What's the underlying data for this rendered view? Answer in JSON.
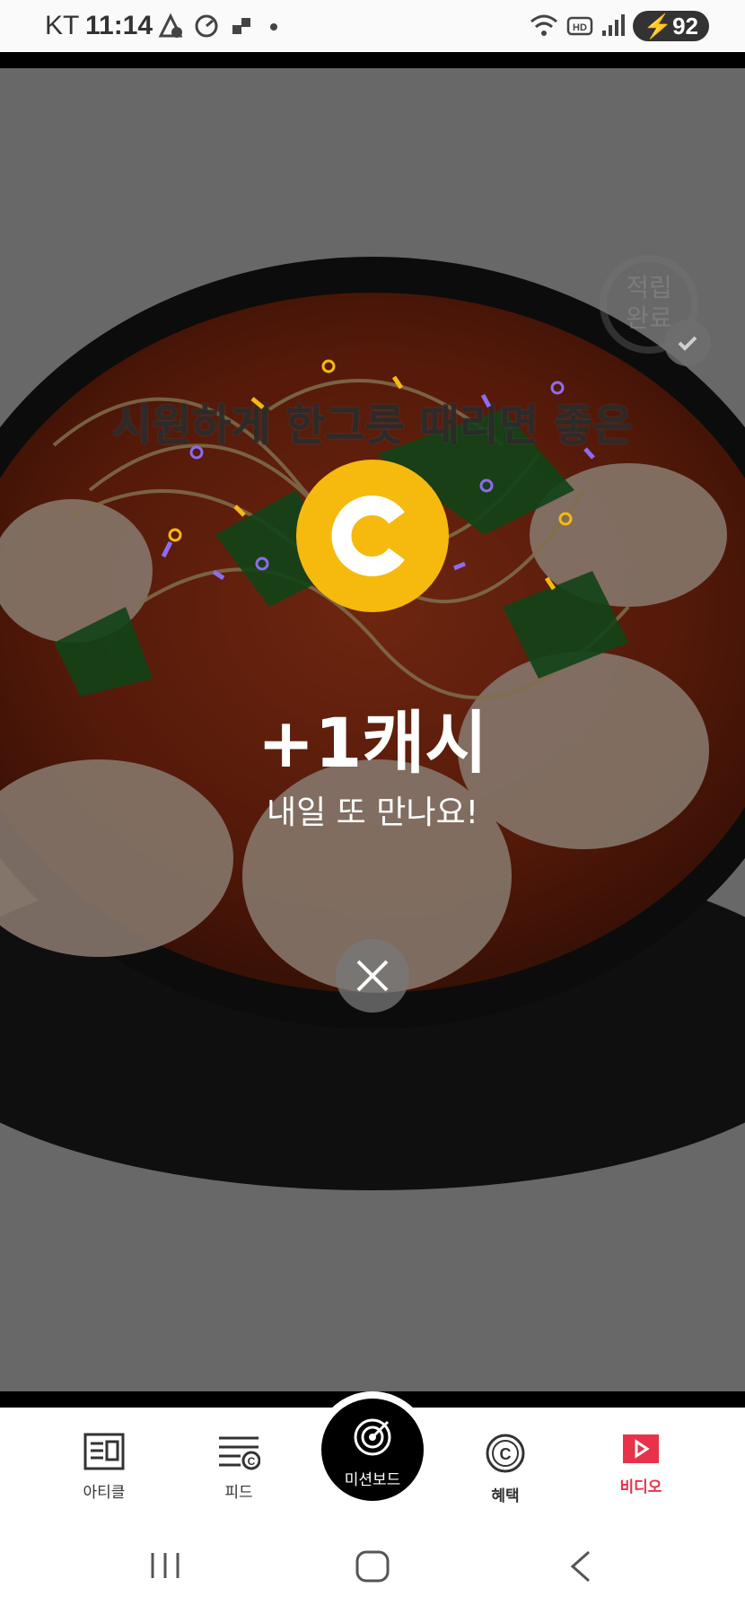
{
  "status_bar": {
    "carrier": "KT",
    "time": "11:14",
    "battery": "92"
  },
  "video": {
    "stamp_text": "적립\n완료",
    "caption": "시원하게 한그릇 때리면 좋은",
    "reward": {
      "title": "+1캐시",
      "subtitle": "내일 또 만나요!",
      "coin_icon": "cash-coin-icon",
      "coin_color": "#f6b90e"
    }
  },
  "bottom_nav": {
    "items": [
      {
        "label": "아티클",
        "icon": "article-icon"
      },
      {
        "label": "피드",
        "icon": "feed-icon"
      },
      {
        "label": "미션보드",
        "icon": "target-icon"
      },
      {
        "label": "혜택",
        "icon": "benefit-coin-icon"
      },
      {
        "label": "비디오",
        "icon": "video-play-icon",
        "active": true
      }
    ],
    "active_color": "#e8324a"
  },
  "system_nav": {
    "recent": "recent-apps-icon",
    "home": "home-icon",
    "back": "back-icon"
  }
}
